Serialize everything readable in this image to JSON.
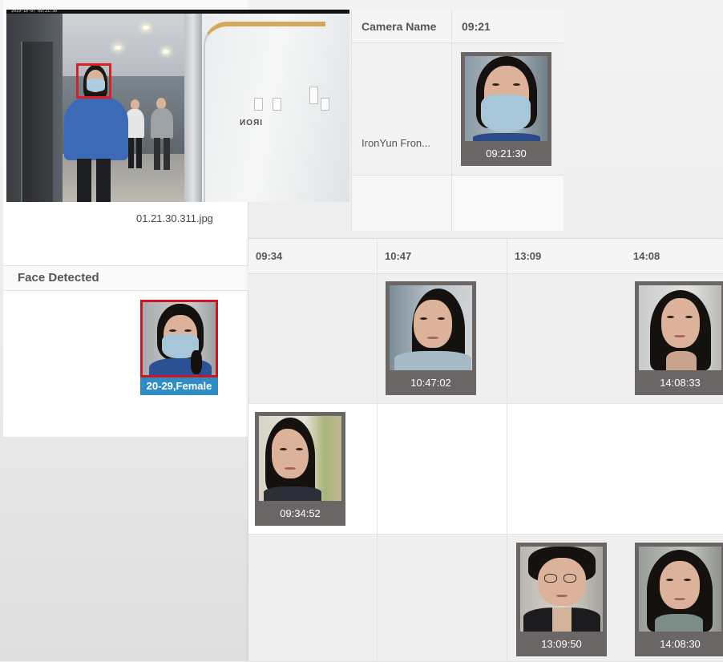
{
  "source": {
    "osd_text": "2019-10-07 09:21:30",
    "filename": "01.21.30.311.jpg"
  },
  "face_detected": {
    "title": "Face Detected",
    "label": "20-29,Female"
  },
  "camera_table": {
    "col_camera": "Camera Name",
    "col_time": "09:21",
    "camera_name": "IronYun Fron...",
    "timestamp": "09:21:30"
  },
  "timeline": {
    "columns": [
      "09:34",
      "10:47",
      "13:09",
      "14:08"
    ],
    "faces": {
      "r0_c1": "10:47:02",
      "r0_c3": "14:08:33",
      "r1_c0": "09:34:52",
      "r2_c2": "13:09:50",
      "r2_c3": "14:08:30"
    }
  },
  "colors": {
    "detect_box": "#e11b22",
    "age_label": "#2f8dc5",
    "card_bg": "#6b6666"
  }
}
